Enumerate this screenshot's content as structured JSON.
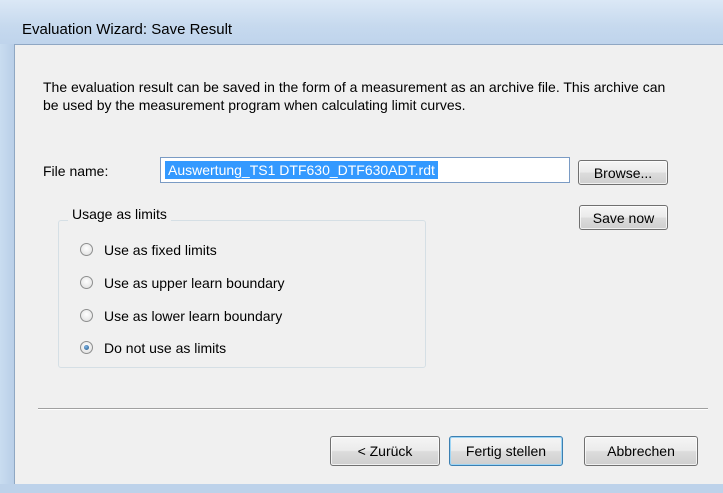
{
  "window": {
    "title": "Evaluation Wizard: Save Result"
  },
  "description": "The evaluation result can be saved in the form of a measurement as an archive file. This archive can be used by the measurement program when calculating limit curves.",
  "file": {
    "label": "File name:",
    "value": "Auswertung_TS1 DTF630_DTF630ADT.rdt",
    "browse_label": "Browse...",
    "save_now_label": "Save now"
  },
  "usage_group": {
    "label": "Usage as limits",
    "options": [
      {
        "label": "Use as fixed limits",
        "checked": false
      },
      {
        "label": "Use as upper learn boundary",
        "checked": false
      },
      {
        "label": "Use as lower learn boundary",
        "checked": false
      },
      {
        "label": "Do not use as limits",
        "checked": true
      }
    ]
  },
  "footer": {
    "back_label": "< Zurück",
    "finish_label": "Fertig stellen",
    "cancel_label": "Abbrechen"
  }
}
